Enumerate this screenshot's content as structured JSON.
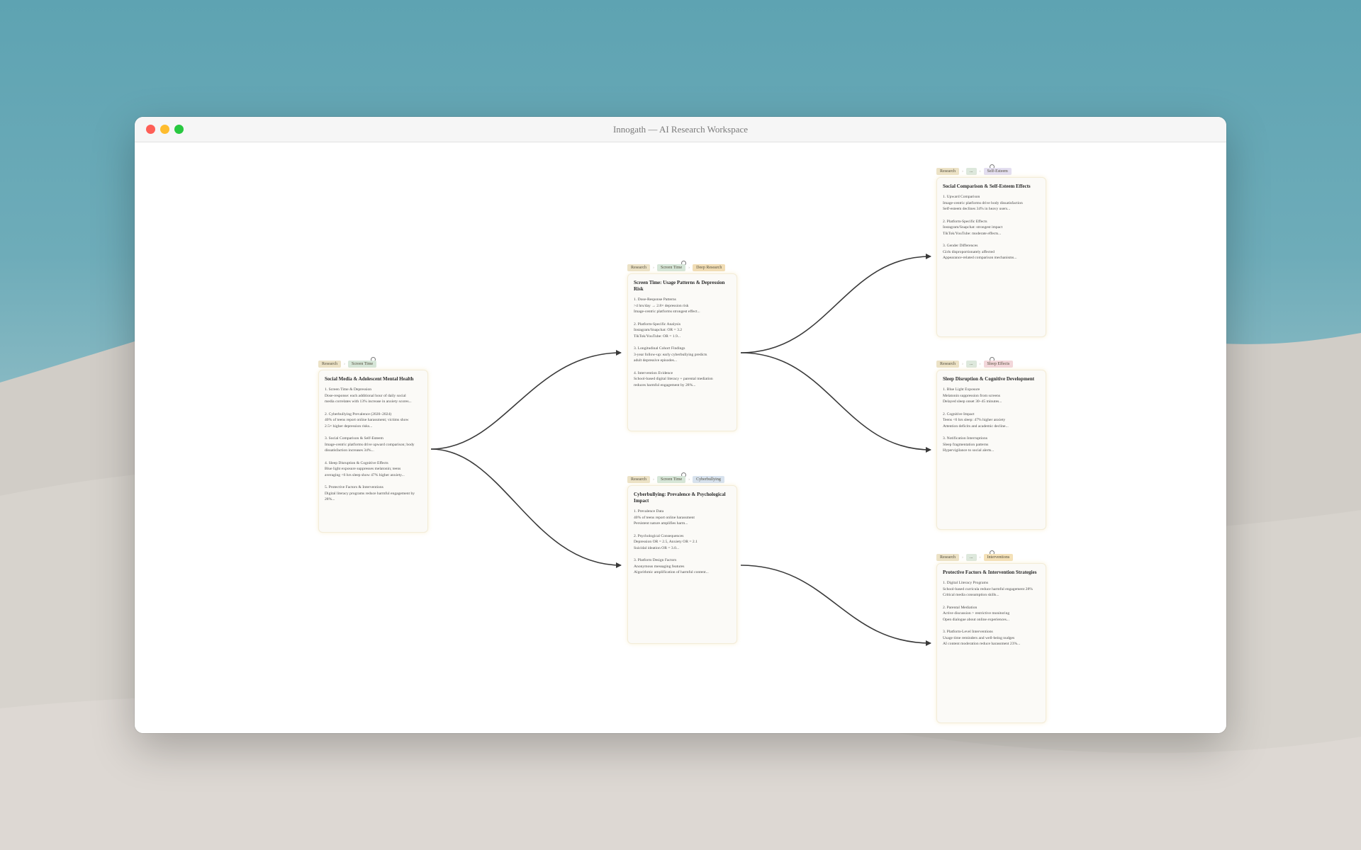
{
  "window": {
    "title": "Innogath — AI Research Workspace"
  },
  "nodes": {
    "root": {
      "tags": [
        "Research",
        "Screen Time"
      ],
      "title": "Social Media & Adolescent Mental Health",
      "sections": [
        [
          "1. Screen Time & Depression",
          "Dose-response: each additional hour of daily social",
          "media correlates with 13% increase in anxiety scores..."
        ],
        [
          "2. Cyberbullying Prevalence (2020–2024)",
          "40% of teens report online harassment; victims show",
          "2.5× higher depression risks..."
        ],
        [
          "3. Social Comparison & Self-Esteem",
          "Image-centric platforms drive upward comparison; body",
          "dissatisfaction increases 34%..."
        ],
        [
          "4. Sleep Disruption & Cognitive Effects",
          "Blue light exposure suppresses melatonin; teens",
          "averaging <6 hrs sleep show 47% higher anxiety..."
        ],
        [
          "5. Protective Factors & Interventions",
          "Digital literacy programs reduce harmful engagement by",
          "28%..."
        ]
      ]
    },
    "screen": {
      "tags": [
        "Research",
        "Screen Time",
        "Deep Research"
      ],
      "title": "Screen Time: Usage Patterns & Depression Risk",
      "sections": [
        [
          "1. Dose-Response Patterns",
          ">4 hrs/day → 2.8× depression risk",
          "Image-centric platforms strongest effect..."
        ],
        [
          "2. Platform-Specific Analysis",
          "Instagram/Snapchat: OR = 3.2",
          "TikTok/YouTube: OR = 1.9..."
        ],
        [
          "3. Longitudinal Cohort Findings",
          "3-year follow-up: early cyberbullying predicts",
          "adult depressive episodes..."
        ],
        [
          "4. Intervention Evidence",
          "School-based digital literacy + parental mediation",
          "reduces harmful engagement by 28%..."
        ]
      ]
    },
    "cyber": {
      "tags": [
        "Research",
        "Screen Time",
        "Cyberbullying"
      ],
      "title": "Cyberbullying: Prevalence & Psychological Impact",
      "sections": [
        [
          "1. Prevalence Data",
          "40% of teens report online harassment",
          "Persistent nature amplifies harm..."
        ],
        [
          "2. Psychological Consequences",
          "Depression OR = 2.5, Anxiety OR = 2.1",
          "Suicidal ideation OR = 3.0..."
        ],
        [
          "3. Platform Design Factors",
          "Anonymous messaging features",
          "Algorithmic amplification of harmful content..."
        ]
      ]
    },
    "self": {
      "tags": [
        "Research",
        "...",
        "Self-Esteem"
      ],
      "title": "Social Comparison & Self-Esteem Effects",
      "sections": [
        [
          "1. Upward Comparison",
          "Image-centric platforms drive body dissatisfaction",
          "Self-esteem declines 34% in heavy users..."
        ],
        [
          "2. Platform-Specific Effects",
          "Instagram/Snapchat: strongest impact",
          "TikTok/YouTube: moderate effects..."
        ],
        [
          "3. Gender Differences",
          "Girls disproportionately affected",
          "Appearance-related comparison mechanisms..."
        ]
      ]
    },
    "sleep": {
      "tags": [
        "Research",
        "...",
        "Sleep Effects"
      ],
      "title": "Sleep Disruption & Cognitive Development",
      "sections": [
        [
          "1. Blue Light Exposure",
          "Melatonin suppression from screens",
          "Delayed sleep onset 30–45 minutes..."
        ],
        [
          "2. Cognitive Impact",
          "Teens <6 hrs sleep: 47% higher anxiety",
          "Attention deficits and academic decline..."
        ],
        [
          "3. Notification Interruptions",
          "Sleep fragmentation patterns",
          "Hypervigilance to social alerts..."
        ]
      ]
    },
    "protect": {
      "tags": [
        "Research",
        "...",
        "Interventions"
      ],
      "title": "Protective Factors & Intervention Strategies",
      "sections": [
        [
          "1. Digital Literacy Programs",
          "School-based curricula reduce harmful engagement 28%",
          "Critical media consumption skills..."
        ],
        [
          "2. Parental Mediation",
          "Active discussion > restrictive monitoring",
          "Open dialogue about online experiences..."
        ],
        [
          "3. Platform-Level Interventions",
          "Usage time reminders and well-being nudges",
          "AI content moderation reduce harassment 23%..."
        ]
      ]
    }
  },
  "colors": {
    "edge": "#3a3a3a",
    "card_bg": "#fbfaf7",
    "card_glow": "#f3e6bd"
  }
}
